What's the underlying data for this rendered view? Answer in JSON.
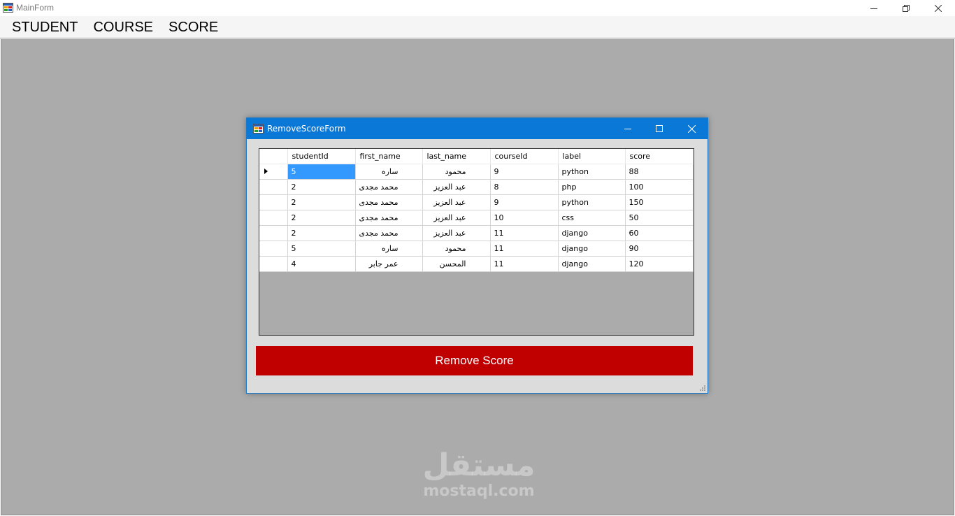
{
  "main_window": {
    "title": "MainForm",
    "menu": [
      "STUDENT",
      "COURSE",
      "SCORE"
    ]
  },
  "child_window": {
    "title": "RemoveScoreForm",
    "grid": {
      "columns": [
        "studentId",
        "first_name",
        "last_name",
        "courseId",
        "label",
        "score"
      ],
      "rows": [
        [
          "5",
          "ساره",
          "محمود",
          "9",
          "python",
          "88"
        ],
        [
          "2",
          "محمد مجدى",
          "عبد العزيز",
          "8",
          "php",
          "100"
        ],
        [
          "2",
          "محمد مجدى",
          "عبد العزيز",
          "9",
          "python",
          "150"
        ],
        [
          "2",
          "محمد مجدى",
          "عبد العزيز",
          "10",
          "css",
          "50"
        ],
        [
          "2",
          "محمد مجدى",
          "عبد العزيز",
          "11",
          "django",
          "60"
        ],
        [
          "5",
          "ساره",
          "محمود",
          "11",
          "django",
          "90"
        ],
        [
          "4",
          "عمر جابر",
          "المحسن",
          "11",
          "django",
          "120"
        ]
      ],
      "selected_row": 0
    },
    "remove_button_label": "Remove Score"
  },
  "watermark": {
    "arabic": "مستقل",
    "latin": "mostaql.com"
  },
  "colors": {
    "title_bar_active": "#0a78d7",
    "remove_button": "#c00000",
    "selection": "#3399ff",
    "mdi_background": "#ababab"
  },
  "icons": {
    "app": "winforms-app-icon",
    "minimize": "minimize-icon",
    "maximize": "maximize-icon",
    "restore": "restore-icon",
    "close": "close-icon",
    "row_indicator": "current-row-arrow-icon",
    "resize_grip": "resize-grip-icon"
  }
}
